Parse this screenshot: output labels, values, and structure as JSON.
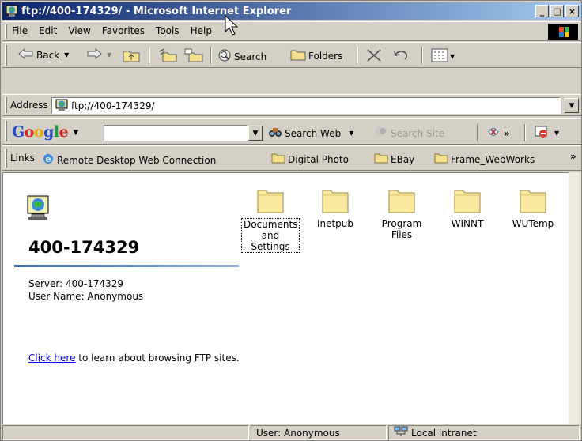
{
  "window": {
    "title": "ftp://400-174329/ - Microsoft Internet Explorer",
    "controls": {
      "minimize": "_",
      "maximize": "□",
      "close": "×"
    }
  },
  "menu": [
    "File",
    "Edit",
    "View",
    "Favorites",
    "Tools",
    "Help"
  ],
  "toolbar": {
    "back_label": "Back",
    "search_label": "Search",
    "folders_label": "Folders"
  },
  "address": {
    "label": "Address",
    "value": "ftp://400-174329/"
  },
  "google": {
    "logo": "Google",
    "search_web_label": "Search Web",
    "search_site_label": "Search Site",
    "more": "»"
  },
  "links": {
    "label": "Links",
    "items": [
      "Remote Desktop Web Connection",
      "Digital Photo",
      "EBay",
      "Frame_WebWorks"
    ],
    "more": "»"
  },
  "content": {
    "host": "400-174329",
    "server_line": "Server: 400-174329",
    "user_line": "User Name: Anonymous",
    "help_link": "Click here",
    "help_text": " to learn about browsing FTP sites.",
    "folders": [
      {
        "label": "Documents and Settings",
        "selected": true
      },
      {
        "label": "Inetpub",
        "selected": false
      },
      {
        "label": "Program Files",
        "selected": false
      },
      {
        "label": "WINNT",
        "selected": false
      },
      {
        "label": "WUTemp",
        "selected": false
      }
    ]
  },
  "status": {
    "user": "User: Anonymous",
    "zone": "Local intranet"
  },
  "colors": {
    "title_gradient_start": "#0a246a",
    "title_gradient_end": "#a6caf0",
    "chrome": "#d4d0c8",
    "folder_fill": "#fbe9a0",
    "link": "#0000ee"
  }
}
